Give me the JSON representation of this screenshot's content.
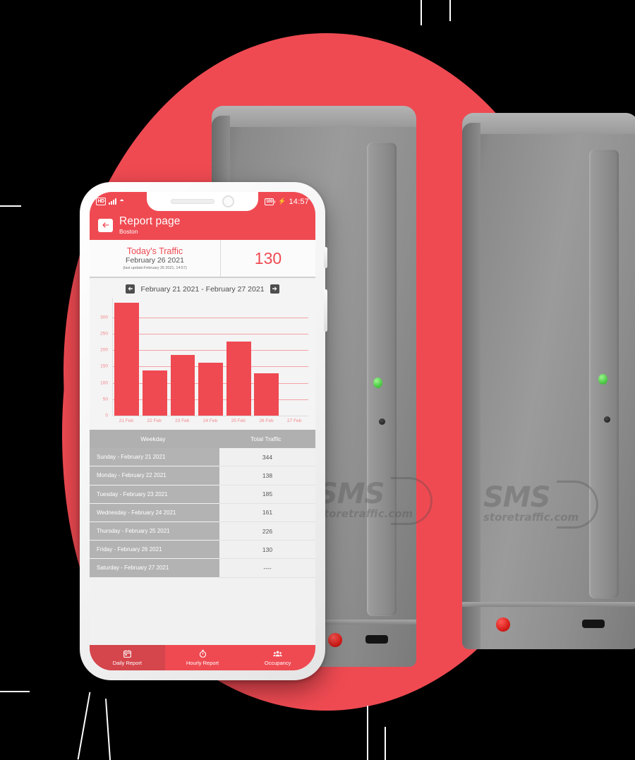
{
  "statusbar": {
    "hd_icon": "hd-icon",
    "signal_icon": "signal-icon",
    "wifi_icon": "wifi-icon",
    "battery_label": "100",
    "charging_icon": "charging-bolt-icon",
    "time": "14:57"
  },
  "appbar": {
    "back_icon": "back-arrow-icon",
    "title": "Report page",
    "subtitle": "Boston"
  },
  "summary": {
    "title": "Today's Traffic",
    "date": "February 26 2021",
    "last_update": "(last update:February 26 2021, 14:57)",
    "value": "130"
  },
  "date_nav": {
    "prev_icon": "arrow-left-icon",
    "next_icon": "arrow-right-icon",
    "range": "February 21 2021 - February 27 2021"
  },
  "table": {
    "headers": [
      "Weekday",
      "Total Traffic"
    ],
    "rows": [
      {
        "weekday": "Sunday - February 21 2021",
        "traffic": "344"
      },
      {
        "weekday": "Monday - February 22 2021",
        "traffic": "138"
      },
      {
        "weekday": "Tuesday - February 23 2021",
        "traffic": "185"
      },
      {
        "weekday": "Wednesday - February 24 2021",
        "traffic": "161"
      },
      {
        "weekday": "Thursday - February 25 2021",
        "traffic": "226"
      },
      {
        "weekday": "Friday - February 26 2021",
        "traffic": "130"
      },
      {
        "weekday": "Saturday - February 27 2021",
        "traffic": "----"
      }
    ]
  },
  "bottomnav": {
    "items": [
      {
        "label": "Daily Report",
        "icon": "calendar-icon",
        "active": true
      },
      {
        "label": "Hourly Report",
        "icon": "stopwatch-icon",
        "active": false
      },
      {
        "label": "Occupancy",
        "icon": "people-icon",
        "active": false
      }
    ]
  },
  "device": {
    "logo_word": "SMS",
    "logo_sub": "storetraffic.com"
  },
  "colors": {
    "brand_red": "#ef4a52",
    "nav_active_red": "#d4454c",
    "bar_red": "#ef4a52",
    "axis_pink": "#f2868c",
    "table_header_gray": "#b0b0b0",
    "table_left_gray": "#b3b3b3",
    "led_green": "#4ecb46",
    "led_red": "#d61a16"
  },
  "chart_data": {
    "type": "bar",
    "title": "February 21 2021 - February 27 2021",
    "categories": [
      "21 Feb",
      "22 Feb",
      "23 Feb",
      "24 Feb",
      "25 Feb",
      "26 Feb",
      "27 Feb"
    ],
    "values": [
      344,
      138,
      185,
      161,
      226,
      130,
      null
    ],
    "yticks": [
      0,
      50,
      100,
      150,
      200,
      250,
      300
    ],
    "ylim": [
      0,
      360
    ],
    "xlabel": "",
    "ylabel": "",
    "grid": true,
    "legend": "none",
    "series": [
      {
        "name": "Total Traffic",
        "values": [
          344,
          138,
          185,
          161,
          226,
          130,
          null
        ]
      }
    ]
  }
}
